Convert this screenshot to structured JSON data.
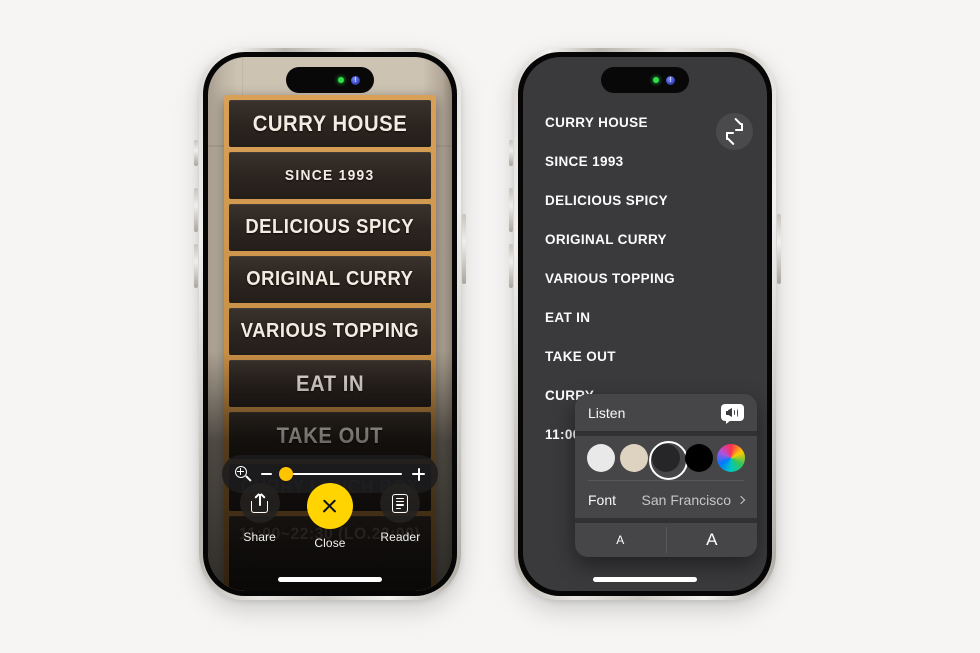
{
  "background_color": "#f6f5f4",
  "left_phone": {
    "name": "iphone-live-text-detection",
    "dynamic_island": {
      "camera_indicator": "green-dot",
      "face_id_indicator": "blue-dot"
    },
    "sign_lines": [
      "CURRY HOUSE",
      "SINCE 1993",
      "DELICIOUS SPICY",
      "ORIGINAL CURRY",
      "VARIOUS TOPPING",
      "EAT IN",
      "TAKE OUT",
      "CURRY LUNCH BOX",
      "11:00~22:30 (LO.22:00)"
    ],
    "zoom_control": {
      "icon": "magnifier-plus-icon",
      "minus_label": "−",
      "plus_label": "+",
      "slider_value": 8,
      "slider_min": 0,
      "slider_max": 100,
      "knob_color": "#ffc400"
    },
    "actions": [
      {
        "label": "Share",
        "icon": "share-icon",
        "style": "dark"
      },
      {
        "label": "Close",
        "icon": "close-x-icon",
        "style": "yellow",
        "accent": "#ffd400"
      },
      {
        "label": "Reader",
        "icon": "reader-document-icon",
        "style": "dark"
      }
    ]
  },
  "right_phone": {
    "name": "iphone-reader-view",
    "dynamic_island": {
      "camera_indicator": "green-dot",
      "face_id_indicator": "blue-dot"
    },
    "collapse_button_icon": "collapse-arrows-icon",
    "reader_lines": [
      "CURRY HOUSE",
      "SINCE 1993",
      "DELICIOUS SPICY",
      "ORIGINAL CURRY",
      "VARIOUS TOPPING",
      "EAT IN",
      "TAKE OUT",
      "CURRY",
      "11:00"
    ],
    "popover": {
      "listen": {
        "label": "Listen",
        "icon": "speaker-wave-icon"
      },
      "theme_colors": [
        {
          "name": "white-theme",
          "hex": "#e9e9e9",
          "selected": false
        },
        {
          "name": "sepia-theme",
          "hex": "#ddd3c0",
          "selected": false
        },
        {
          "name": "dark-theme",
          "hex": "#262628",
          "selected": true
        },
        {
          "name": "black-theme",
          "hex": "#000000",
          "selected": false
        },
        {
          "name": "color-wheel",
          "hex": "rainbow",
          "selected": false
        }
      ],
      "font": {
        "label": "Font",
        "value": "San Francisco",
        "chevron": "chevron-right-icon"
      },
      "text_size": {
        "decrease_label": "A",
        "increase_label": "A"
      }
    },
    "text_format_button": {
      "label_small": "A",
      "label_large": "A",
      "name": "aa-text-size-button"
    }
  }
}
